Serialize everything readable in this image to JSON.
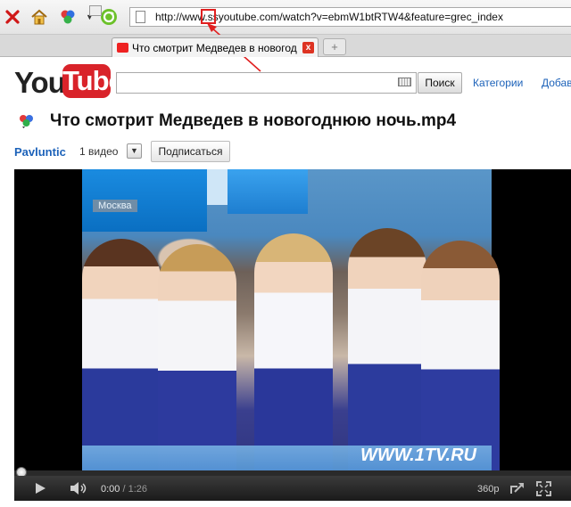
{
  "browser": {
    "url": "http://www.ssyoutube.com/watch?v=ebmW1btRTW4&feature=grec_index",
    "tab_title": "Что смотрит Медведев в новогодн...",
    "tab_close": "x",
    "new_tab": "+",
    "icons": [
      "stop-icon",
      "home-icon",
      "addons-icon",
      "dropdown-icon",
      "refresh-icon",
      "page-icon"
    ]
  },
  "youtube": {
    "logo_you": "You",
    "logo_tube": "Tube",
    "search_placeholder": "",
    "search_button": "Поиск",
    "nav": [
      "Категории",
      "Добав"
    ]
  },
  "video": {
    "title": "Что смотрит Медведев в новогоднюю ночь.mp4",
    "channel": "Pavluntic",
    "video_count": "1 видео",
    "subscribe": "Подписаться",
    "overlay_city": "Москва",
    "watermark": "WWW.1TV.RU",
    "time_current": "0:00",
    "time_duration": " / 1:26",
    "quality": "360p",
    "progress_fraction": 0.0
  },
  "colors": {
    "highlight": "#e02020",
    "link": "#1c62b9",
    "logo_red": "#d9232a"
  }
}
